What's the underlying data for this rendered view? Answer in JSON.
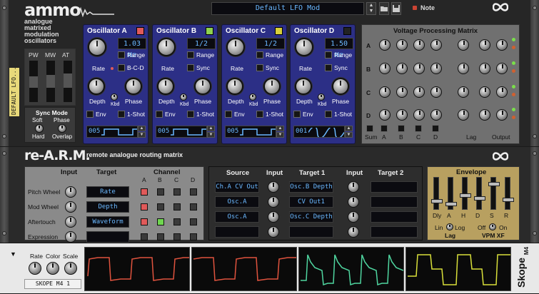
{
  "ammo": {
    "brand": "ammo",
    "subtitle_lines": [
      "analogue",
      "matrixed",
      "modulation",
      "oscillators"
    ],
    "patch_name": "Default LFO Mod",
    "note_label": "Note",
    "vertical_label": "DEFAULT LFO...",
    "meter_labels": [
      "PW",
      "MW",
      "AT"
    ],
    "sync_mode": {
      "title": "Sync Mode",
      "soft": "Soft",
      "phase": "Phase",
      "hard": "Hard",
      "overlap": "Overlap"
    },
    "oscillators": [
      {
        "title": "Oscillator A",
        "value": "1.03 Hz",
        "opt1": "Range",
        "opt2": "B-C-D",
        "wave_num": "005",
        "wave_type": "square",
        "led": "#e05a5a"
      },
      {
        "title": "Oscillator B",
        "value": "1/2",
        "opt1": "Range",
        "opt2": "Sync",
        "wave_num": "005",
        "wave_type": "square",
        "led": "#8fd14f"
      },
      {
        "title": "Oscillator C",
        "value": "1/2",
        "opt1": "Range",
        "opt2": "Sync",
        "wave_num": "005",
        "wave_type": "square",
        "led": "#d9d03a"
      },
      {
        "title": "Oscillator D",
        "value": "1.50 Hz",
        "opt1": "Range",
        "opt2": "Sync",
        "wave_num": "001",
        "wave_type": "sine",
        "led": "#222"
      }
    ],
    "osc_labels": {
      "rate": "Rate",
      "depth": "Depth",
      "phase": "Phase",
      "kbd": "Kbd",
      "env": "Env",
      "oneshot": "1-Shot"
    },
    "vpm": {
      "title": "Voltage Processing Matrix",
      "rows": [
        "A",
        "B",
        "C",
        "D"
      ],
      "cols": [
        "A",
        "B",
        "C",
        "D"
      ],
      "sum_label": "Sum",
      "lag_label": "Lag",
      "output_label": "Output"
    }
  },
  "rearm": {
    "brand": "re-A.R.M.",
    "subtitle": "remote analogue routing matrix",
    "headers": {
      "input": "Input",
      "target": "Target",
      "channel": "Channel",
      "channel_cols": [
        "A",
        "B",
        "C",
        "D"
      ],
      "source": "Source",
      "input2": "Input",
      "target1": "Target 1",
      "input3": "Input",
      "target2": "Target 2",
      "envelope": "Envelope"
    },
    "rows": [
      {
        "input": "Pitch Wheel",
        "target": "Rate",
        "active": 0
      },
      {
        "input": "Mod Wheel",
        "target": "Depth",
        "active": 0
      },
      {
        "input": "Aftertouch",
        "target": "Waveform",
        "active": 0
      },
      {
        "input": "Expression",
        "target": "",
        "active": -1
      }
    ],
    "routes": [
      {
        "source": "Ch.A CV Out",
        "target1": "Osc.B Depth",
        "target2": ""
      },
      {
        "source": "Osc.A",
        "target1": "CV Out1",
        "target2": ""
      },
      {
        "source": "Osc.A",
        "target1": "Osc.C Depth",
        "target2": ""
      },
      {
        "source": "",
        "target1": "",
        "target2": ""
      }
    ],
    "envelope_labels": [
      "Dly",
      "A",
      "H",
      "D",
      "S",
      "R"
    ],
    "lin": "Lin",
    "log": "Log",
    "lag": "Lag",
    "off": "Off",
    "on": "On",
    "vpm_xf": "VPM XF"
  },
  "skope": {
    "rate": "Rate",
    "color": "Color",
    "scale": "Scale",
    "name": "SKOPE M4 1",
    "brand": "Skope",
    "model": "M4",
    "trace_colors": [
      "#e0533e",
      "#e0533e",
      "#4fd6a0",
      "#d9e03a"
    ]
  },
  "colors": {
    "osc_panel": "#2c2f86",
    "lcd_text": "#6ab8ff"
  }
}
